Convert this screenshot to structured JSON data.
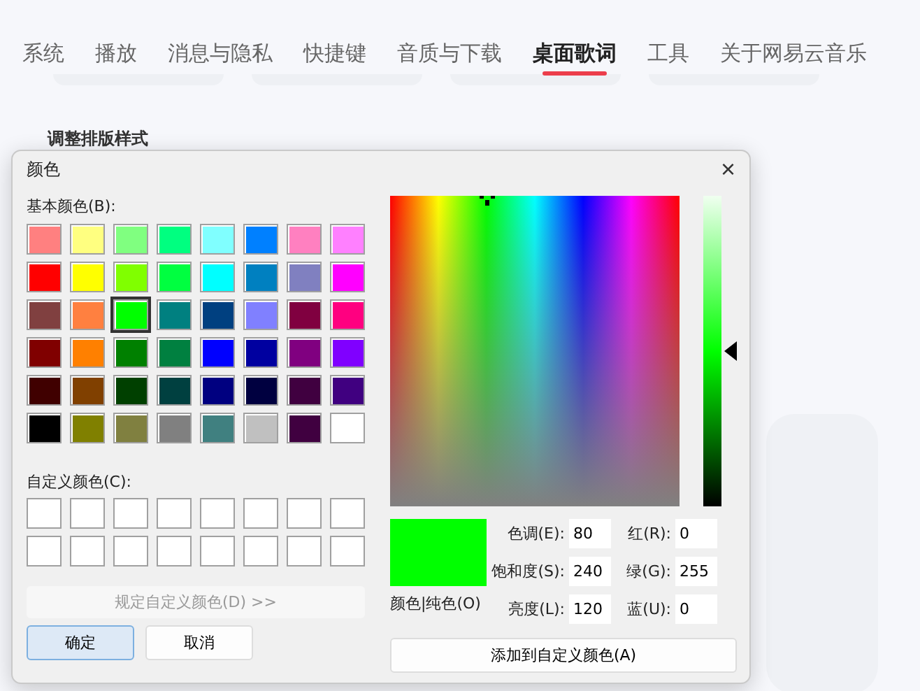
{
  "tabs": [
    {
      "label": "系统",
      "selected": false
    },
    {
      "label": "播放",
      "selected": false
    },
    {
      "label": "消息与隐私",
      "selected": false
    },
    {
      "label": "快捷键",
      "selected": false
    },
    {
      "label": "音质与下载",
      "selected": false
    },
    {
      "label": "桌面歌词",
      "selected": true
    },
    {
      "label": "工具",
      "selected": false
    },
    {
      "label": "关于网易云音乐",
      "selected": false
    }
  ],
  "section_title": "调整排版样式",
  "dialog": {
    "title": "颜色",
    "close": "×",
    "basic_label": "基本颜色(B):",
    "basic_colors": [
      {
        "color": "#ff8080",
        "selected": false
      },
      {
        "color": "#ffff80",
        "selected": false
      },
      {
        "color": "#80ff80",
        "selected": false
      },
      {
        "color": "#00ff80",
        "selected": false
      },
      {
        "color": "#80ffff",
        "selected": false
      },
      {
        "color": "#0080ff",
        "selected": false
      },
      {
        "color": "#ff80c0",
        "selected": false
      },
      {
        "color": "#ff80ff",
        "selected": false
      },
      {
        "color": "#ff0000",
        "selected": false
      },
      {
        "color": "#ffff00",
        "selected": false
      },
      {
        "color": "#80ff00",
        "selected": false
      },
      {
        "color": "#00ff40",
        "selected": false
      },
      {
        "color": "#00ffff",
        "selected": false
      },
      {
        "color": "#0080c0",
        "selected": false
      },
      {
        "color": "#8080c0",
        "selected": false
      },
      {
        "color": "#ff00ff",
        "selected": false
      },
      {
        "color": "#804040",
        "selected": false
      },
      {
        "color": "#ff8040",
        "selected": false
      },
      {
        "color": "#00ff00",
        "selected": true
      },
      {
        "color": "#008080",
        "selected": false
      },
      {
        "color": "#004080",
        "selected": false
      },
      {
        "color": "#8080ff",
        "selected": false
      },
      {
        "color": "#800040",
        "selected": false
      },
      {
        "color": "#ff0080",
        "selected": false
      },
      {
        "color": "#800000",
        "selected": false
      },
      {
        "color": "#ff8000",
        "selected": false
      },
      {
        "color": "#008000",
        "selected": false
      },
      {
        "color": "#008040",
        "selected": false
      },
      {
        "color": "#0000ff",
        "selected": false
      },
      {
        "color": "#0000a0",
        "selected": false
      },
      {
        "color": "#800080",
        "selected": false
      },
      {
        "color": "#8000ff",
        "selected": false
      },
      {
        "color": "#400000",
        "selected": false
      },
      {
        "color": "#804000",
        "selected": false
      },
      {
        "color": "#004000",
        "selected": false
      },
      {
        "color": "#004040",
        "selected": false
      },
      {
        "color": "#000080",
        "selected": false
      },
      {
        "color": "#000040",
        "selected": false
      },
      {
        "color": "#400040",
        "selected": false
      },
      {
        "color": "#400080",
        "selected": false
      },
      {
        "color": "#000000",
        "selected": false
      },
      {
        "color": "#808000",
        "selected": false
      },
      {
        "color": "#808040",
        "selected": false
      },
      {
        "color": "#808080",
        "selected": false
      },
      {
        "color": "#408080",
        "selected": false
      },
      {
        "color": "#c0c0c0",
        "selected": false
      },
      {
        "color": "#400040",
        "selected": false
      },
      {
        "color": "#ffffff",
        "selected": false
      }
    ],
    "custom_label": "自定义颜色(C):",
    "custom_colors": [
      {
        "color": "#ffffff"
      },
      {
        "color": "#ffffff"
      },
      {
        "color": "#ffffff"
      },
      {
        "color": "#ffffff"
      },
      {
        "color": "#ffffff"
      },
      {
        "color": "#ffffff"
      },
      {
        "color": "#ffffff"
      },
      {
        "color": "#ffffff"
      },
      {
        "color": "#ffffff"
      },
      {
        "color": "#ffffff"
      },
      {
        "color": "#ffffff"
      },
      {
        "color": "#ffffff"
      },
      {
        "color": "#ffffff"
      },
      {
        "color": "#ffffff"
      },
      {
        "color": "#ffffff"
      },
      {
        "color": "#ffffff"
      }
    ],
    "define_button": {
      "label": "规定自定义颜色(D) >>",
      "disabled": true
    },
    "ok_button": "确定",
    "cancel_button": "取消",
    "luminance": {
      "level": 0.5
    },
    "preview": {
      "color": "#00ff00",
      "label": "颜色|纯色(O)"
    },
    "fields": [
      {
        "label": "色调(E):",
        "value": "80"
      },
      {
        "label": "红(R):",
        "value": "0"
      },
      {
        "label": "饱和度(S):",
        "value": "240"
      },
      {
        "label": "绿(G):",
        "value": "255"
      },
      {
        "label": "亮度(L):",
        "value": "120"
      },
      {
        "label": "蓝(U):",
        "value": "0"
      }
    ],
    "add_button": "添加到自定义颜色(A)"
  }
}
